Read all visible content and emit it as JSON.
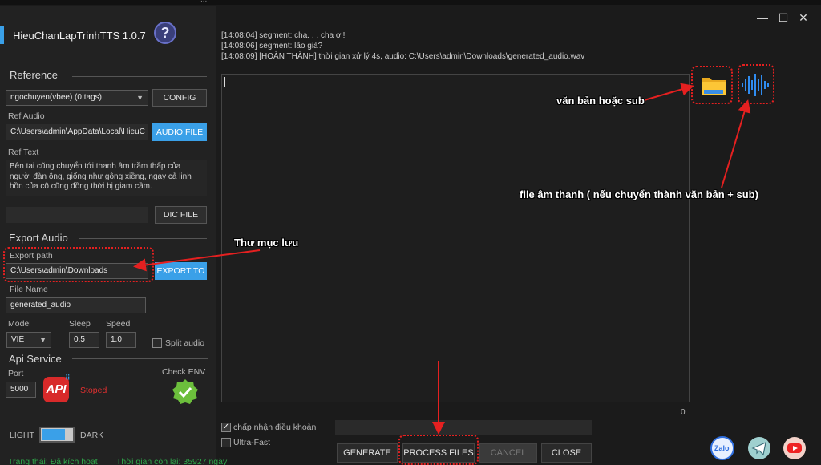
{
  "window": {
    "title": "HieuChanLapTrinhTTS 1.0.7",
    "top_text": "...",
    "controls": {
      "minimize": "—",
      "maximize": "☐",
      "close": "✕"
    },
    "help_symbol": "?"
  },
  "reference": {
    "title": "Reference",
    "voice_select": "ngochuyen(vbee) (0 tags)",
    "config_button": "CONFIG",
    "ref_audio_label": "Ref Audio",
    "ref_audio_path": "C:\\Users\\admin\\AppData\\Local\\HieuC",
    "audio_file_button": "AUDIO FILE",
    "ref_text_label": "Ref Text",
    "ref_text": "Bên tai cũng chuyển tới thanh âm trầm thấp của người đàn ông, giống như gông xiềng, ngay cả linh hồn của cô cũng đồng thời bị giam cầm.",
    "dic_value": "",
    "dic_file_button": "DIC FILE"
  },
  "export": {
    "title": "Export Audio",
    "export_path_label": "Export path",
    "export_path": "C:\\Users\\admin\\Downloads",
    "export_to_button": "EXPORT TO",
    "file_name_label": "File Name",
    "file_name": "generated_audio",
    "model_label": "Model",
    "model_value": "VIE",
    "sleep_label": "Sleep",
    "sleep_value": "0.5",
    "speed_label": "Speed",
    "speed_value": "1.0",
    "split_audio_label": "Split audio",
    "split_audio_checked": false
  },
  "api": {
    "title": "Api Service",
    "port_label": "Port",
    "port_value": "5000",
    "api_logo_text": "API",
    "status": "Stoped",
    "check_env_label": "Check ENV"
  },
  "theme": {
    "light": "LIGHT",
    "dark": "DARK"
  },
  "footer_status": {
    "status": "Trạng thái: Đã kích hoạt",
    "time_left": "Thời gian còn lại: 35927 ngày"
  },
  "log_lines": [
    "[14:08:04] segment: cha. . . cha ơi!",
    "[14:08:06] segment: lão già?",
    "[14:08:09] [HOÀN THÀNH] thời gian xử lý 4s, audio: C:\\Users\\admin\\Downloads\\generated_audio.wav ."
  ],
  "char_count": "0",
  "options": {
    "accept_terms": "chấp nhận điều khoản",
    "accept_terms_checked": true,
    "ultra_fast": "Ultra-Fast",
    "ultra_fast_checked": false
  },
  "buttons": {
    "generate": "GENERATE",
    "process_files": "PROCESS FILES",
    "cancel": "CANCEL",
    "close": "CLOSE"
  },
  "annotations": {
    "text_or_sub": "văn bản hoặc sub",
    "audio_file_note": "file âm thanh ( nếu chuyển thành văn bản + sub)",
    "save_folder": "Thư mục lưu"
  },
  "social": {
    "zalo": "Zalo"
  },
  "colors": {
    "accent": "#3aa0e8",
    "annotation_red": "#e52020",
    "status_green": "#2ea84a",
    "stoped_red": "#e03030"
  }
}
